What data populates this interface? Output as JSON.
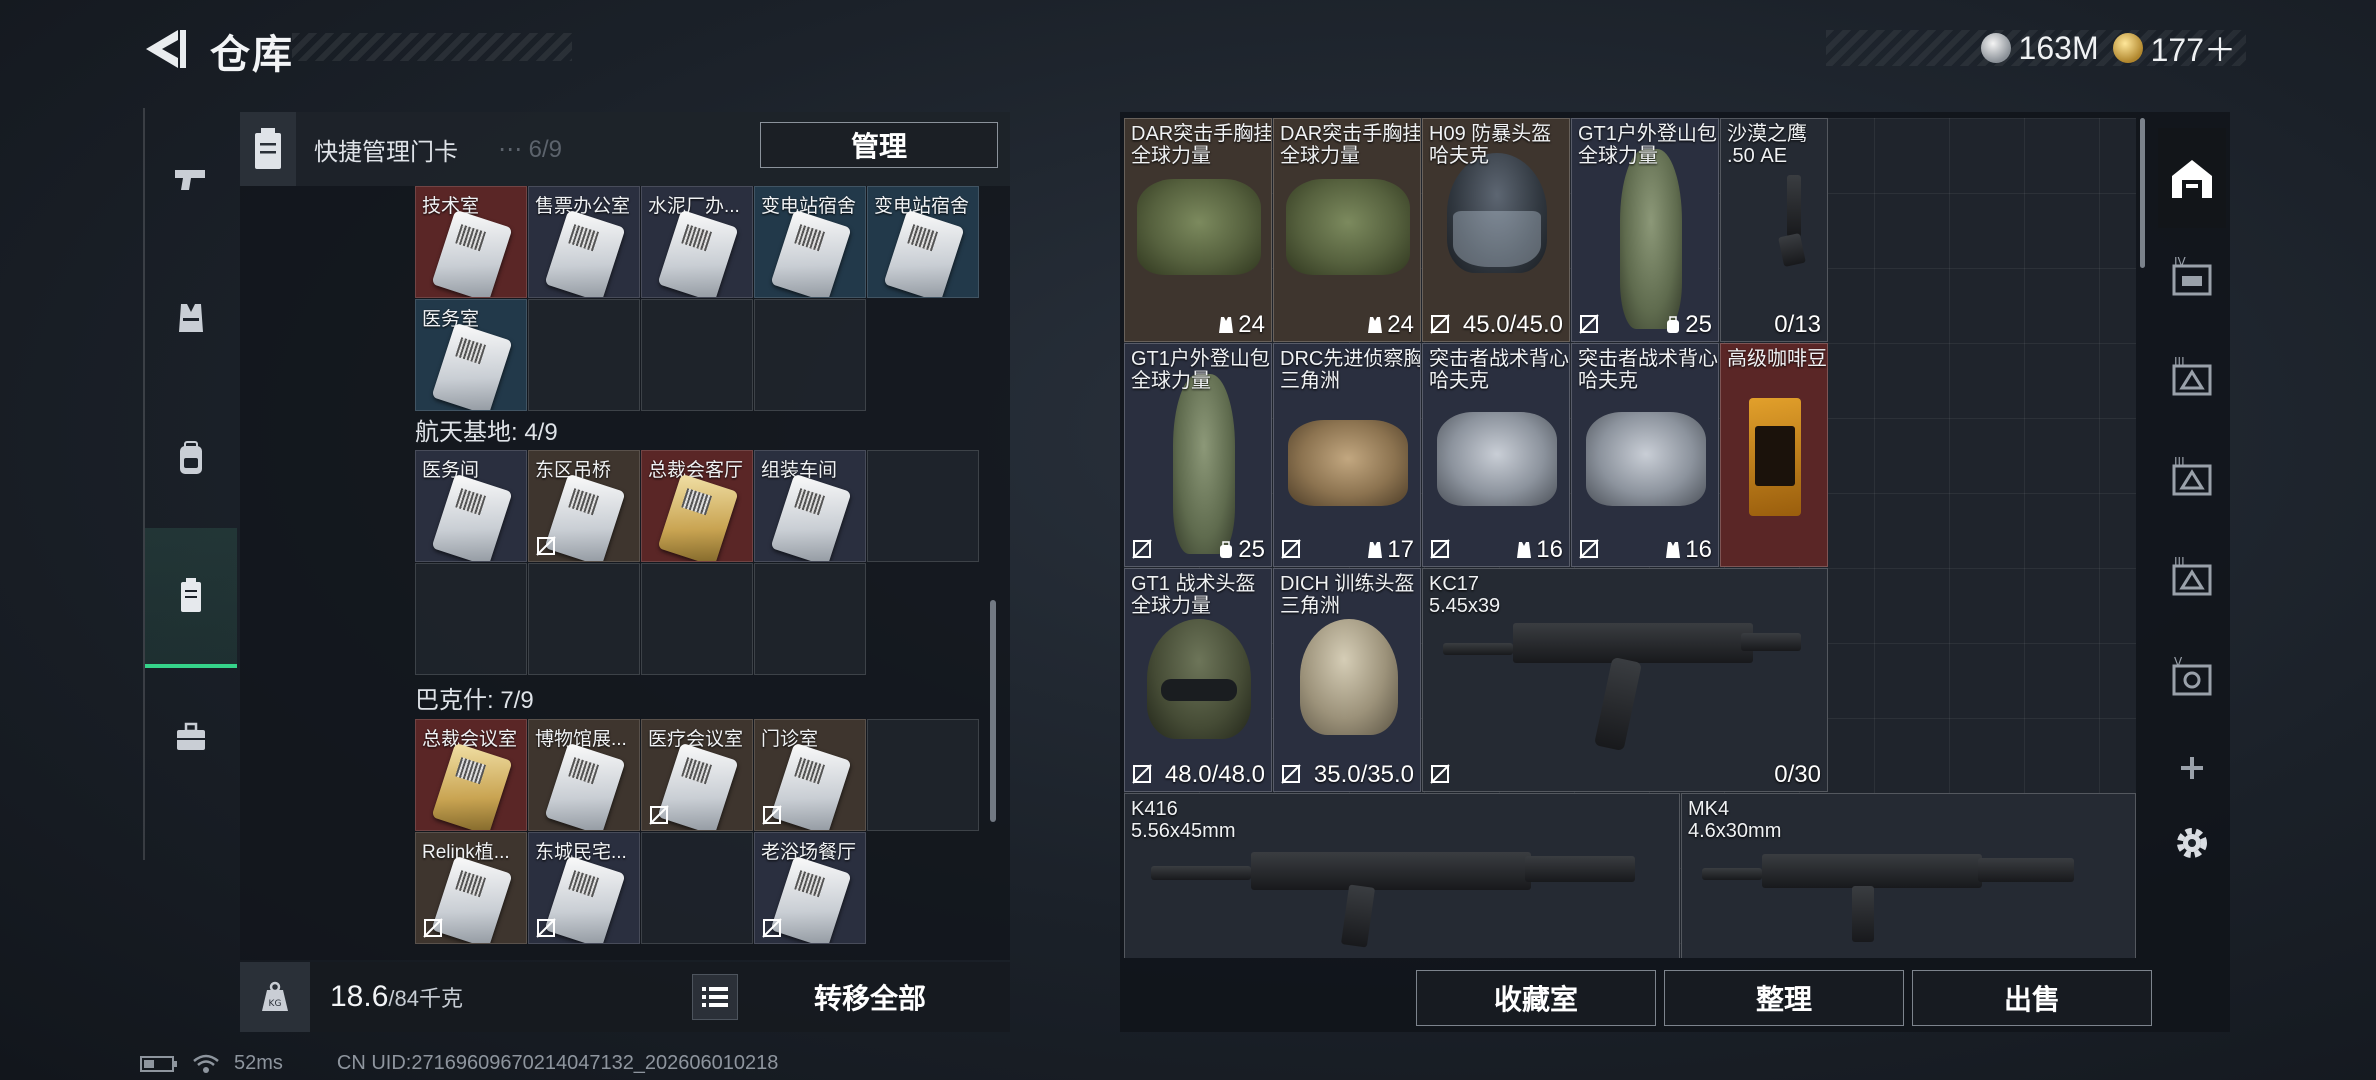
{
  "header": {
    "title": "仓库"
  },
  "currency": {
    "silver": "163M",
    "gold": "177＋"
  },
  "quick_bar": {
    "label": "快捷管理门卡",
    "manage_label": "管理",
    "partial_group": "⋯ 6/9"
  },
  "key_groups": [
    {
      "title": "",
      "cards": [
        "技术室",
        "售票办公室",
        "水泥厂办...",
        "变电站宿舍",
        "变电站宿舍",
        "医务室"
      ]
    },
    {
      "title": "航天基地: 4/9",
      "cards": [
        "医务间",
        "东区吊桥",
        "总裁会客厅",
        "组装车间"
      ]
    },
    {
      "title": "巴克什: 7/9",
      "cards": [
        "总裁会议室",
        "博物馆展...",
        "医疗会议室",
        "门诊室",
        "Relink植...",
        "东城民宅...",
        "老浴场餐厅"
      ]
    }
  ],
  "left_footer": {
    "weight_value": "18.6",
    "weight_max": "/84千克",
    "transfer_all": "转移全部"
  },
  "stash_items": [
    {
      "name": "DAR突击手胸挂",
      "sub": "全球力量",
      "value": "24",
      "icon": "vest-icon"
    },
    {
      "name": "DAR突击手胸挂",
      "sub": "全球力量",
      "value": "24",
      "icon": "vest-icon"
    },
    {
      "name": "H09 防暴头盔",
      "sub": "哈夫克",
      "value": "45.0/45.0"
    },
    {
      "name": "GT1户外登山包",
      "sub": "全球力量",
      "value": "25",
      "icon": "backpack-icon"
    },
    {
      "name": "沙漠之鹰",
      "sub": ".50 AE",
      "value": "0/13"
    },
    {
      "name": "GT1户外登山包",
      "sub": "全球力量",
      "value": "25",
      "icon": "backpack-icon"
    },
    {
      "name": "DRC先进侦察胸挂",
      "sub": "三角洲",
      "value": "17",
      "icon": "vest-icon"
    },
    {
      "name": "突击者战术背心",
      "sub": "哈夫克",
      "value": "16",
      "icon": "vest-icon"
    },
    {
      "name": "突击者战术背心",
      "sub": "哈夫克",
      "value": "16",
      "icon": "vest-icon"
    },
    {
      "name": "高级咖啡豆",
      "sub": "",
      "value": ""
    },
    {
      "name": "GT1 战术头盔",
      "sub": "全球力量",
      "value": "48.0/48.0"
    },
    {
      "name": "DICH 训练头盔",
      "sub": "三角洲",
      "value": "35.0/35.0"
    },
    {
      "name": "KC17",
      "sub": "5.45x39",
      "value": "0/30"
    },
    {
      "name": "K416",
      "sub": "5.56x45mm",
      "value": ""
    },
    {
      "name": "MK4",
      "sub": "4.6x30mm",
      "value": ""
    }
  ],
  "bottom_buttons": {
    "collection": "收藏室",
    "organize": "整理",
    "sell": "出售"
  },
  "status": {
    "ping": "52ms",
    "uid": "CN UID:27169609670214047132_202606010218"
  },
  "colors": {
    "accent": "#35d48a",
    "rare_red": "#5a2626",
    "rare_brown": "#3e352e",
    "rare_navy": "#2a2f3f"
  }
}
